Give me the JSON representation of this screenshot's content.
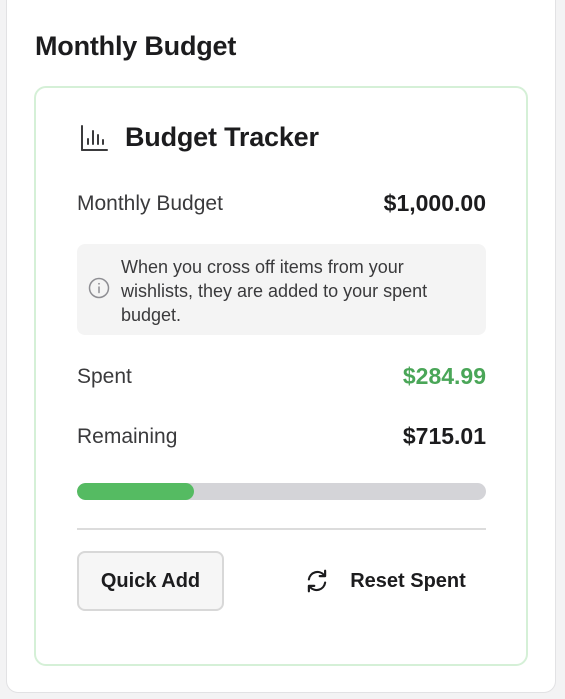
{
  "section": {
    "title": "Monthly Budget"
  },
  "tracker": {
    "title": "Budget Tracker",
    "icon": "bar-chart-icon",
    "monthly_budget": {
      "label": "Monthly Budget",
      "value": "$1,000.00"
    },
    "info": {
      "icon": "info-circle-icon",
      "text": "When you cross off items from your wishlists, they are added to your spent budget."
    },
    "spent": {
      "label": "Spent",
      "value": "$284.99"
    },
    "remaining": {
      "label": "Remaining",
      "value": "$715.01"
    },
    "progress": {
      "fraction": 0.285
    }
  },
  "actions": {
    "quick_add_label": "Quick Add",
    "reset_label": "Reset Spent",
    "reset_icon": "refresh-icon"
  },
  "colors": {
    "accent_green": "#4aa658",
    "progress_fill": "#55bb62",
    "card_border": "#d5f0d7"
  }
}
